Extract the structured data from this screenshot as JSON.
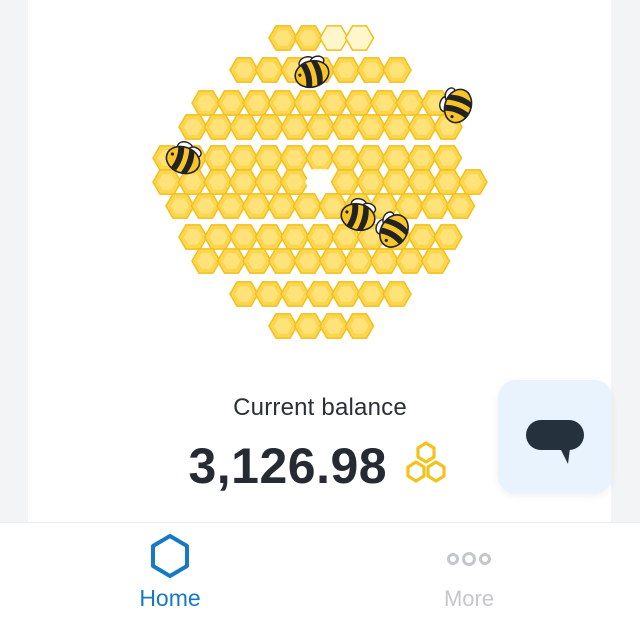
{
  "balance": {
    "label": "Current balance",
    "value": "3,126.98",
    "currency_icon": "honeycomb-coin-icon"
  },
  "chat_button": {
    "icon": "chat-bubble-icon"
  },
  "hive": {
    "icon": "honeycomb-hive-illustration",
    "bee_icon": "bee-icon"
  },
  "nav": {
    "items": [
      {
        "label": "Home",
        "icon": "hexagon-home-icon",
        "active": true
      },
      {
        "label": "More",
        "icon": "more-dots-icon",
        "active": false
      }
    ]
  },
  "colors": {
    "honey": "#fcd64d",
    "honey_stroke": "#f2bf1d",
    "empty_cell": "#fff6cc",
    "accent_blue": "#1779c6",
    "chat_bg": "#e8f3fd",
    "chat_icon": "#25323d",
    "text_dark": "#252a33",
    "nav_inactive": "#c4c7cc"
  }
}
